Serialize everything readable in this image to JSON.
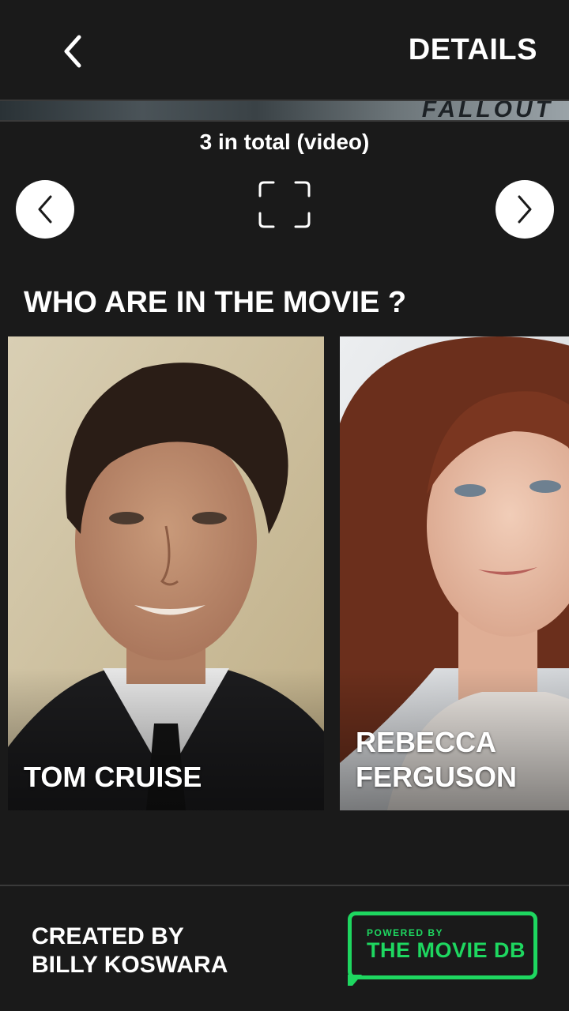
{
  "header": {
    "back_icon": "chevron-left-icon",
    "title": "DETAILS"
  },
  "trailer": {
    "strip_text": "FALLOUT",
    "count_label": "3 in total (video)",
    "prev_icon": "chevron-left-icon",
    "next_icon": "chevron-right-icon",
    "fullscreen_icon": "fullscreen-icon"
  },
  "cast": {
    "section_title": "WHO ARE IN THE MOVIE ?",
    "members": [
      {
        "name": "TOM CRUISE"
      },
      {
        "name": "REBECCA FERGUSON"
      }
    ]
  },
  "footer": {
    "credit_line1": "CREATED BY",
    "credit_line2": "BILLY KOSWARA",
    "logo_small": "POWERED BY",
    "logo_big": "THE MOVIE DB"
  },
  "colors": {
    "background": "#1a1a1a",
    "text": "#ffffff",
    "tmdb_green": "#1ed760"
  }
}
